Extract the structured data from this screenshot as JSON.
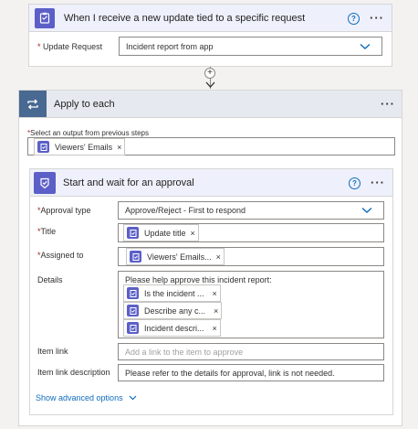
{
  "trigger": {
    "title": "When I receive a new update tied to a specific request",
    "help_glyph": "?",
    "more_glyph": "···",
    "update_request_label": "Update Request",
    "update_request_value": "Incident report from app",
    "icon": "clipboard-icon",
    "accent": "#5b5fc7"
  },
  "connector": {
    "plus_glyph": "+"
  },
  "apply_each": {
    "title": "Apply to each",
    "more_glyph": "···",
    "icon": "loop-icon",
    "accent": "#486991",
    "select_label": "Select an output from previous steps",
    "token": "Viewers' Emails"
  },
  "approval": {
    "title": "Start and wait for an approval",
    "help_glyph": "?",
    "more_glyph": "···",
    "icon": "approval-icon",
    "accent": "#5b5fc7",
    "approval_type_label": "Approval type",
    "approval_type_value": "Approve/Reject - First to respond",
    "title_label": "Title",
    "title_token": "Update title",
    "assigned_label": "Assigned to",
    "assigned_token": "Viewers' Emails...",
    "details_label": "Details",
    "details_text": "Please help approve this incident report:",
    "details_tokens": [
      "Is the incident ...",
      "Describe any c...",
      "Incident descri..."
    ],
    "item_link_label": "Item link",
    "item_link_placeholder": "Add a link to the item to approve",
    "item_link_desc_label": "Item link description",
    "item_link_desc_value": "Please refer to the details for approval, link is not needed.",
    "show_advanced": "Show advanced options"
  },
  "req_mark": "*",
  "remove_glyph": "×"
}
